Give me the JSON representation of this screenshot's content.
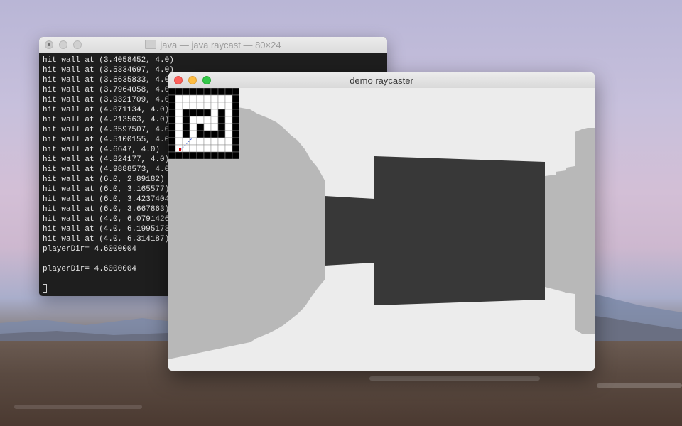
{
  "terminal": {
    "title": "java — java raycast — 80×24",
    "lines": [
      "hit wall at (3.4058452, 4.0)",
      "hit wall at (3.5334697, 4.0)",
      "hit wall at (3.6635833, 4.0)",
      "hit wall at (3.7964058, 4.0)",
      "hit wall at (3.9321709, 4.0)",
      "hit wall at (4.071134, 4.0)",
      "hit wall at (4.213563, 4.0)",
      "hit wall at (4.3597507, 4.0)",
      "hit wall at (4.5100155, 4.0)",
      "hit wall at (4.6647, 4.0)",
      "hit wall at (4.824177, 4.0)",
      "hit wall at (4.9888573, 4.0)",
      "hit wall at (6.0, 2.89182)",
      "hit wall at (6.0, 3.165577)",
      "hit wall at (6.0, 3.4237404)",
      "hit wall at (6.0, 3.667863)",
      "hit wall at (4.0, 6.0791426)",
      "hit wall at (4.0, 6.1995173)",
      "hit wall at (4.0, 6.314187)",
      "playerDir= 4.6000004",
      "",
      "playerDir= 4.6000004",
      ""
    ],
    "icons": {
      "folder": "folder-icon"
    }
  },
  "raycaster": {
    "title": "demo raycaster",
    "colors": {
      "ceiling_floor": "#ececec",
      "wall_side": "#b8b8b8",
      "wall_front": "#383838"
    },
    "minimap": {
      "rows": [
        "##########",
        "#........#",
        "#........#",
        "#.####.#.#",
        "#.#....#.#",
        "#.#.#..#.#",
        "#.#.####.#",
        "#........#",
        "#........#",
        "##########"
      ]
    }
  },
  "window_controls": {
    "close": "close-button",
    "minimize": "minimize-button",
    "zoom": "zoom-button"
  }
}
